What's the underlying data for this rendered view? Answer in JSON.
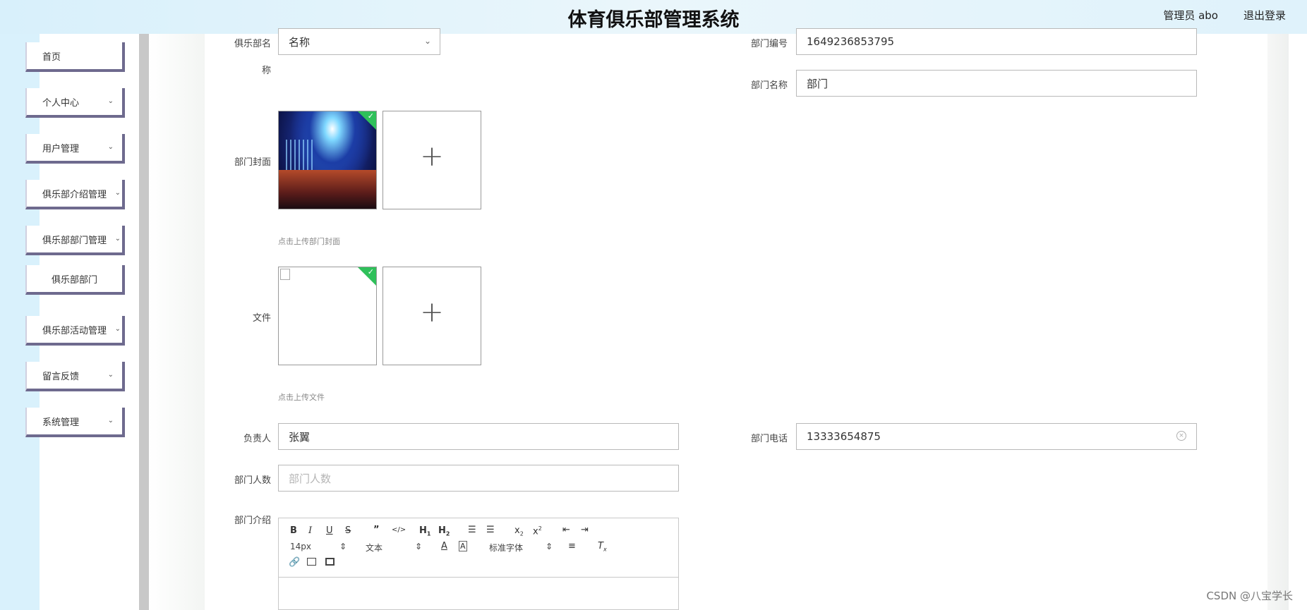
{
  "header": {
    "title": "体育俱乐部管理系统",
    "user": "管理员 abo",
    "logout": "退出登录"
  },
  "sidebar": {
    "items": [
      {
        "label": "首页",
        "has_arrow": false
      },
      {
        "label": "个人中心",
        "has_arrow": true
      },
      {
        "label": "用户管理",
        "has_arrow": true
      },
      {
        "label": "俱乐部介绍管理",
        "has_arrow": true
      },
      {
        "label": "俱乐部部门管理",
        "has_arrow": true
      },
      {
        "label": "俱乐部部门",
        "sub": true
      },
      {
        "label": "俱乐部活动管理",
        "has_arrow": true
      },
      {
        "label": "留言反馈",
        "has_arrow": true
      },
      {
        "label": "系统管理",
        "has_arrow": true
      }
    ]
  },
  "form": {
    "club_name_label": "俱乐部名称",
    "club_name_label_a": "俱乐部名",
    "club_name_label_b": "称",
    "club_name_value": "名称",
    "dept_no_label": "部门编号",
    "dept_no_value": "1649236853795",
    "dept_name_label": "部门名称",
    "dept_name_value": "部门",
    "cover_label": "部门封面",
    "cover_hint": "点击上传部门封面",
    "file_label": "文件",
    "file_hint": "点击上传文件",
    "leader_label": "负责人",
    "leader_value": "张翼",
    "phone_label": "部门电话",
    "phone_value": "13333654875",
    "count_label": "部门人数",
    "count_placeholder": "部门人数",
    "intro_label": "部门介绍"
  },
  "editor": {
    "font_size": "14px",
    "text_style": "文本",
    "font_family": "标准字体"
  },
  "watermark": "CSDN @八宝学长",
  "colors": {
    "header_bg": "#dff2fb",
    "nav_border": "#6e6a8e",
    "check_green": "#2fc05a"
  }
}
